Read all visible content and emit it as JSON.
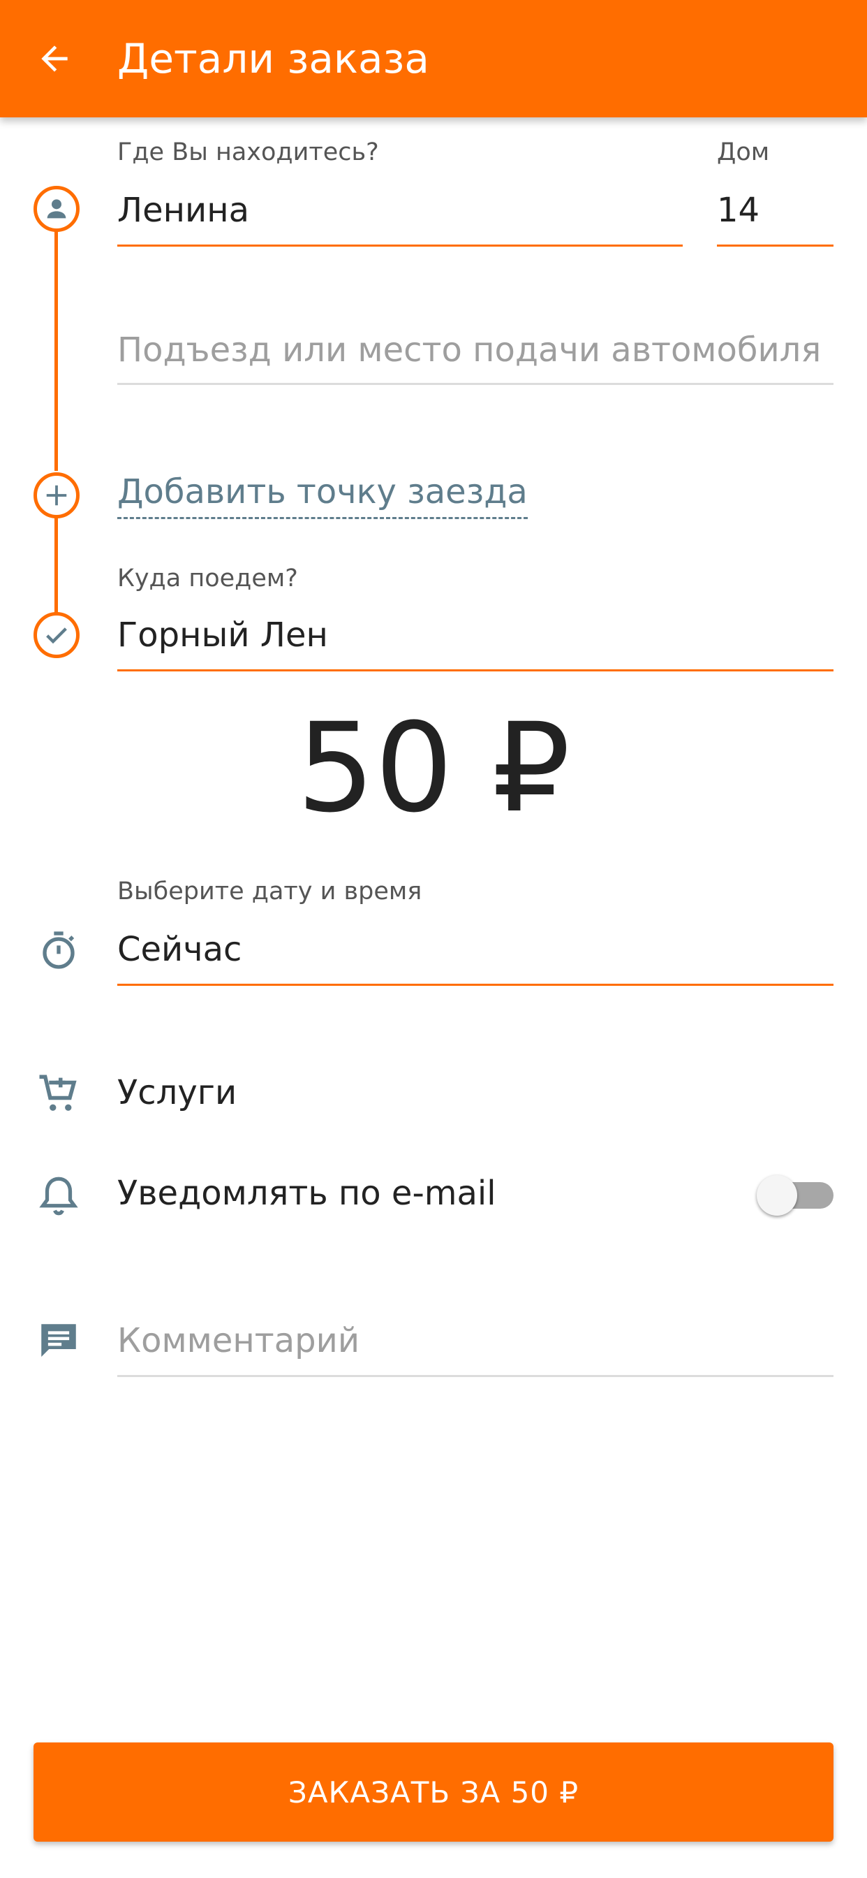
{
  "appbar": {
    "title": "Детали заказа",
    "back_icon": "arrow-left-icon",
    "color": "#ff6d00"
  },
  "pickup": {
    "label": "Где Вы находитесь?",
    "value": "Ленина",
    "house_label": "Дом",
    "house_value": "14",
    "entrance_placeholder": "Подъезд или место подачи автомобиля",
    "icon": "person-icon"
  },
  "add_stop": {
    "label": "Добавить точку заезда",
    "icon": "plus-icon"
  },
  "destination": {
    "label": "Куда поедем?",
    "value": "Горный Лен",
    "icon": "check-icon"
  },
  "price": {
    "text": "50 ₽"
  },
  "datetime": {
    "label": "Выберите дату и время",
    "value": "Сейчас",
    "icon": "stopwatch-icon"
  },
  "services": {
    "label": "Услуги",
    "icon": "cart-plus-icon"
  },
  "email_notify": {
    "label": "Уведомлять по e-mail",
    "icon": "bell-icon",
    "enabled": false
  },
  "comment": {
    "placeholder": "Комментарий",
    "icon": "comment-icon"
  },
  "order_button": {
    "label": "ЗАКАЗАТЬ ЗА 50 ₽"
  },
  "colors": {
    "accent": "#ff6d00",
    "icon_grey": "#5f7d8c"
  }
}
